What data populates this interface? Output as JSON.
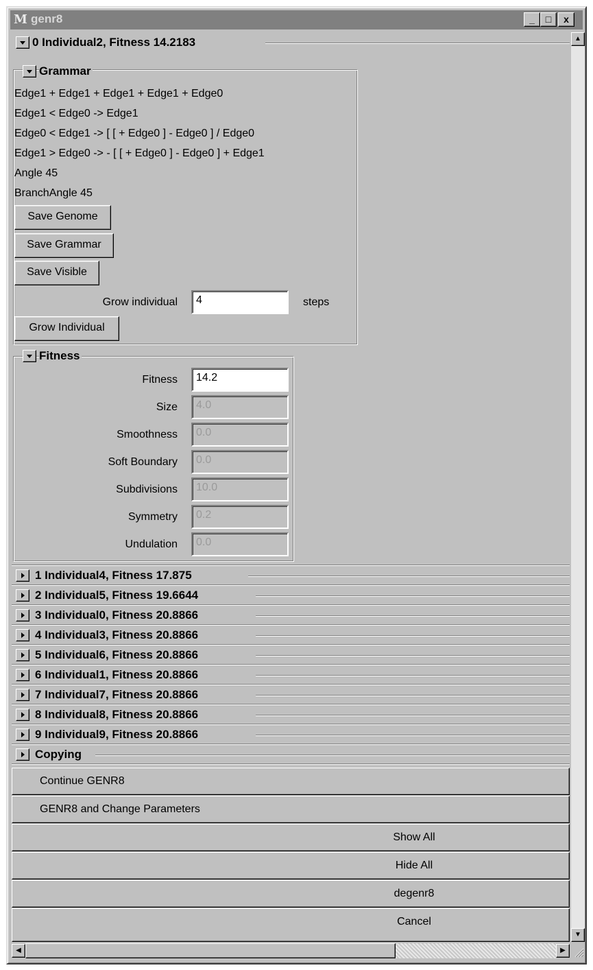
{
  "window": {
    "title": "genr8",
    "icon_label": "M",
    "controls": {
      "minimize": "_",
      "maximize": "□",
      "close": "x"
    }
  },
  "individual0": {
    "header": "0 Individual2, Fitness 14.2183",
    "grammar": {
      "header": "Grammar",
      "lines": [
        "Edge1 + Edge1 + Edge1 + Edge1 + Edge0",
        "Edge1 < Edge0 -> Edge1",
        "Edge0 < Edge1 ->  [ [ + Edge0 ] - Edge0 ] / Edge0",
        "Edge1 > Edge0 -> - [ [ + Edge0 ] - Edge0 ] + Edge1",
        "Angle 45",
        "BranchAngle 45"
      ],
      "save_genome": "Save Genome",
      "save_grammar": "Save Grammar",
      "save_visible": "Save Visible",
      "grow_label": "Grow individual",
      "grow_value": "4",
      "grow_unit": "steps",
      "grow_button": "Grow Individual"
    },
    "fitness": {
      "header": "Fitness",
      "rows": [
        {
          "label": "Fitness",
          "value": "14.2",
          "editable": true
        },
        {
          "label": "Size",
          "value": "4.0",
          "editable": false
        },
        {
          "label": "Smoothness",
          "value": "0.0",
          "editable": false
        },
        {
          "label": "Soft Boundary",
          "value": "0.0",
          "editable": false
        },
        {
          "label": "Subdivisions",
          "value": "10.0",
          "editable": false
        },
        {
          "label": "Symmetry",
          "value": "0.2",
          "editable": false
        },
        {
          "label": "Undulation",
          "value": "0.0",
          "editable": false
        }
      ]
    }
  },
  "collapsed": [
    "1 Individual4, Fitness 17.875",
    "2 Individual5, Fitness 19.6644",
    "3 Individual0, Fitness 20.8866",
    "4 Individual3, Fitness 20.8866",
    "5 Individual6, Fitness 20.8866",
    "6 Individual1, Fitness 20.8866",
    "7 Individual7, Fitness 20.8866",
    "8 Individual8, Fitness 20.8866",
    "9 Individual9, Fitness 20.8866",
    "Copying"
  ],
  "actions": [
    {
      "label": "Continue GENR8",
      "offset": 40
    },
    {
      "label": "GENR8 and Change Parameters",
      "offset": 40
    },
    {
      "label": "Show All",
      "offset": 0
    },
    {
      "label": "Hide All",
      "offset": 0
    },
    {
      "label": "degenr8",
      "offset": 0
    },
    {
      "label": "Cancel",
      "offset": 0
    }
  ]
}
